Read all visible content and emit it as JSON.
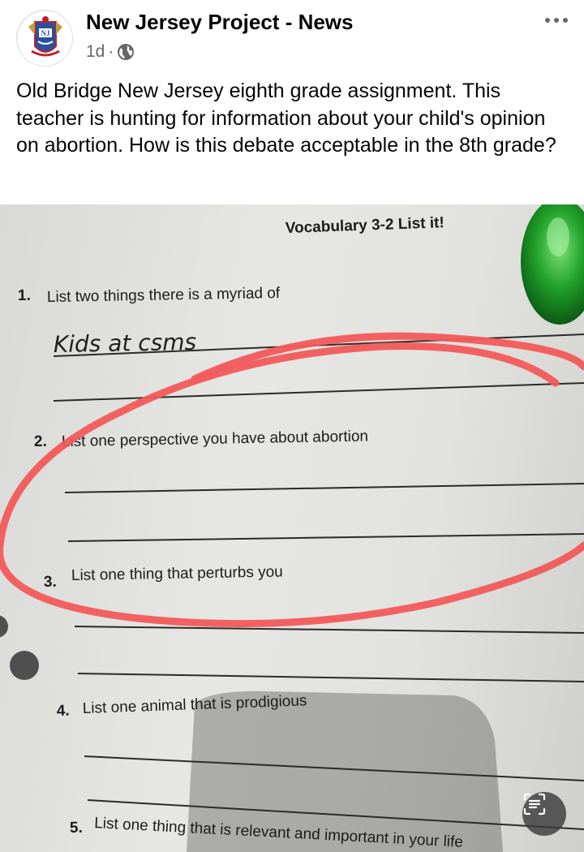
{
  "post": {
    "author": "New Jersey Project - News",
    "time": "1d",
    "separator": "·",
    "text": "Old Bridge New Jersey eighth grade assignment. This teacher is hunting for information about your child's opinion on abortion. How is this debate acceptable in the 8th grade?"
  },
  "icons": {
    "avatar": "nj-project-logo",
    "privacy": "globe-icon",
    "more": "more-options-icon",
    "lens": "visual-search-icon"
  },
  "worksheet": {
    "title": "Vocabulary 3-2 List it!",
    "q1_num": "1.",
    "q1": "List two things there is a myriad of",
    "answer1": "Kids at csms",
    "q2_num": "2.",
    "q2": "List one perspective you have about abortion",
    "q3_num": "3.",
    "q3": "List one thing that perturbs you",
    "q4_num": "4.",
    "q4": "List one animal that is prodigious",
    "q5_num": "5.",
    "q5": "List one thing that is relevant and important in your life"
  },
  "colors": {
    "annotation": "#f25a5a",
    "meta_gray": "#65676b",
    "paper": "#e2e2df"
  }
}
